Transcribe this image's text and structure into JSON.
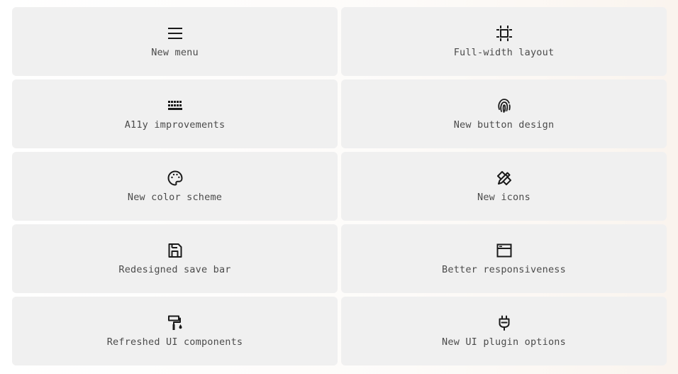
{
  "features": [
    {
      "label": "New menu",
      "icon": "menu-icon"
    },
    {
      "label": "Full-width layout",
      "icon": "crop-icon"
    },
    {
      "label": "A11y improvements",
      "icon": "keyboard-icon"
    },
    {
      "label": "New button design",
      "icon": "fingerprint-icon"
    },
    {
      "label": "New color scheme",
      "icon": "palette-icon"
    },
    {
      "label": "New icons",
      "icon": "design-tools-icon"
    },
    {
      "label": "Redesigned save bar",
      "icon": "floppy-disk-icon"
    },
    {
      "label": "Better responsiveness",
      "icon": "browser-window-icon"
    },
    {
      "label": "Refreshed UI components",
      "icon": "paint-roller-icon"
    },
    {
      "label": "New UI plugin options",
      "icon": "plug-icon"
    }
  ],
  "colors": {
    "card_background": "#f0f0f0",
    "label_text": "#4b4b4b",
    "icon_stroke": "#1a1a1a"
  }
}
